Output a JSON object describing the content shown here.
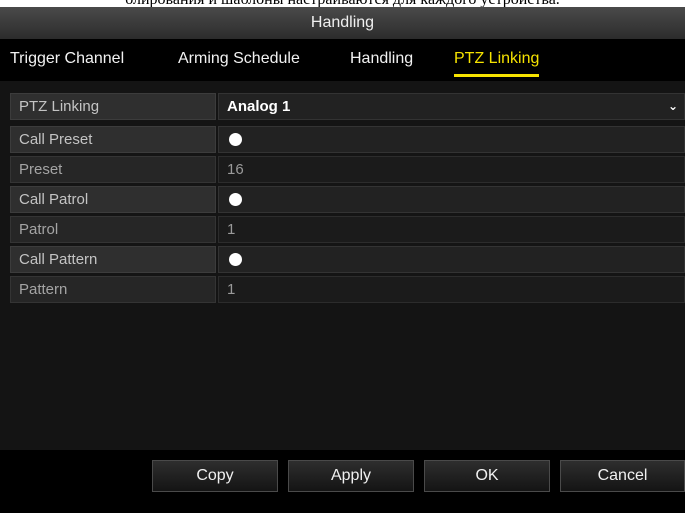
{
  "caption": "олирования и шаблоны настраиваются для каждого устройства.",
  "window": {
    "title": "Handling"
  },
  "tabs": [
    {
      "label": "Trigger Channel",
      "active": false
    },
    {
      "label": "Arming Schedule",
      "active": false
    },
    {
      "label": "Handling",
      "active": false
    },
    {
      "label": "PTZ Linking",
      "active": true
    }
  ],
  "ptz": {
    "linking_label": "PTZ Linking",
    "linking_value": "Analog 1",
    "call_preset_label": "Call Preset",
    "call_preset_checked": true,
    "preset_label": "Preset",
    "preset_value": "16",
    "call_patrol_label": "Call Patrol",
    "call_patrol_checked": true,
    "patrol_label": "Patrol",
    "patrol_value": "1",
    "call_pattern_label": "Call Pattern",
    "call_pattern_checked": true,
    "pattern_label": "Pattern",
    "pattern_value": "1"
  },
  "buttons": {
    "copy": "Copy",
    "apply": "Apply",
    "ok": "OK",
    "cancel": "Cancel"
  },
  "colors": {
    "accent": "#f6e300",
    "background": "#141414"
  }
}
